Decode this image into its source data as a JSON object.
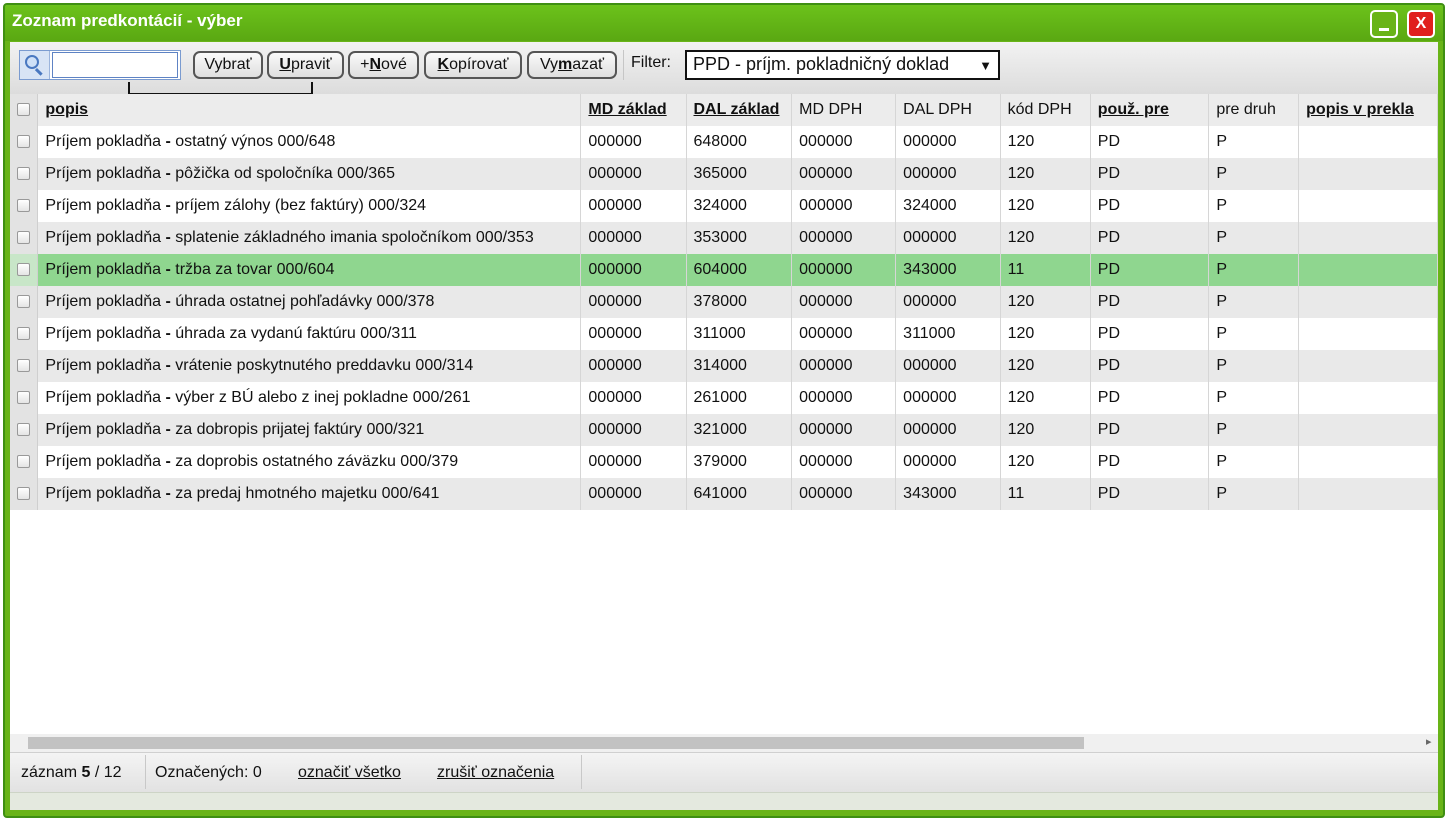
{
  "window": {
    "title": "Zoznam predkontácií - výber",
    "minimize_label": "_",
    "close_label": "X"
  },
  "toolbar": {
    "search_value": "",
    "buttons": {
      "select": {
        "pre": "Vybrať",
        "key": "",
        "post": ""
      },
      "edit": {
        "pre": "",
        "key": "U",
        "post": "praviť"
      },
      "new": {
        "pre": "+",
        "key": "N",
        "post": "ové"
      },
      "copy": {
        "pre": "",
        "key": "K",
        "post": "opírovať"
      },
      "delete": {
        "pre": "Vy",
        "key": "m",
        "post": "azať"
      }
    },
    "filter_label": "Filter:",
    "filter_value": "PPD - príjm. pokladničný doklad",
    "filter_arrow": "▼"
  },
  "table": {
    "columns": [
      "popis",
      "MD základ",
      "DAL základ",
      "MD DPH",
      "DAL DPH",
      "kód DPH",
      "použ. pre",
      "pre druh",
      "popis v prekla"
    ],
    "rows": [
      {
        "prefix": "Príjem pokladňa",
        "rest": "ostatný výnos 000/648",
        "md": "000000",
        "dal": "648000",
        "mddph": "000000",
        "daldph": "000000",
        "kod": "120",
        "pouz": "PD",
        "druh": "P",
        "prekl": ""
      },
      {
        "prefix": "Príjem pokladňa",
        "rest": "pôžička od spoločníka 000/365",
        "md": "000000",
        "dal": "365000",
        "mddph": "000000",
        "daldph": "000000",
        "kod": "120",
        "pouz": "PD",
        "druh": "P",
        "prekl": ""
      },
      {
        "prefix": "Príjem pokladňa",
        "rest": "príjem zálohy (bez faktúry) 000/324",
        "md": "000000",
        "dal": "324000",
        "mddph": "000000",
        "daldph": "324000",
        "kod": "120",
        "pouz": "PD",
        "druh": "P",
        "prekl": ""
      },
      {
        "prefix": "Príjem pokladňa",
        "rest": "splatenie základného imania spoločníkom 000/353",
        "md": "000000",
        "dal": "353000",
        "mddph": "000000",
        "daldph": "000000",
        "kod": "120",
        "pouz": "PD",
        "druh": "P",
        "prekl": ""
      },
      {
        "prefix": "Príjem pokladňa",
        "rest": "tržba za tovar 000/604",
        "md": "000000",
        "dal": "604000",
        "mddph": "000000",
        "daldph": "343000",
        "kod": "11",
        "pouz": "PD",
        "druh": "P",
        "prekl": ""
      },
      {
        "prefix": "Príjem pokladňa",
        "rest": "úhrada ostatnej pohľadávky 000/378",
        "md": "000000",
        "dal": "378000",
        "mddph": "000000",
        "daldph": "000000",
        "kod": "120",
        "pouz": "PD",
        "druh": "P",
        "prekl": ""
      },
      {
        "prefix": "Príjem pokladňa",
        "rest": "úhrada za vydanú faktúru 000/311",
        "md": "000000",
        "dal": "311000",
        "mddph": "000000",
        "daldph": "311000",
        "kod": "120",
        "pouz": "PD",
        "druh": "P",
        "prekl": ""
      },
      {
        "prefix": "Príjem pokladňa",
        "rest": "vrátenie poskytnutého preddavku 000/314",
        "md": "000000",
        "dal": "314000",
        "mddph": "000000",
        "daldph": "000000",
        "kod": "120",
        "pouz": "PD",
        "druh": "P",
        "prekl": ""
      },
      {
        "prefix": "Príjem pokladňa",
        "rest": "výber z BÚ alebo z inej pokladne 000/261",
        "md": "000000",
        "dal": "261000",
        "mddph": "000000",
        "daldph": "000000",
        "kod": "120",
        "pouz": "PD",
        "druh": "P",
        "prekl": ""
      },
      {
        "prefix": "Príjem pokladňa",
        "rest": "za dobropis prijatej faktúry 000/321",
        "md": "000000",
        "dal": "321000",
        "mddph": "000000",
        "daldph": "000000",
        "kod": "120",
        "pouz": "PD",
        "druh": "P",
        "prekl": ""
      },
      {
        "prefix": "Príjem pokladňa",
        "rest": "za doprobis ostatného záväzku 000/379",
        "md": "000000",
        "dal": "379000",
        "mddph": "000000",
        "daldph": "000000",
        "kod": "120",
        "pouz": "PD",
        "druh": "P",
        "prekl": ""
      },
      {
        "prefix": "Príjem pokladňa",
        "rest": "za predaj hmotného majetku 000/641",
        "md": "000000",
        "dal": "641000",
        "mddph": "000000",
        "daldph": "343000",
        "kod": "11",
        "pouz": "PD",
        "druh": "P",
        "prekl": ""
      }
    ]
  },
  "status": {
    "record_label": "záznam",
    "record_current": "5",
    "record_total": "/ 12",
    "marked": "Označených: 0",
    "mark_all": "označiť všetko",
    "unmark": "zrušiť označenia"
  },
  "colors": {
    "title_green": "#69b418",
    "selected_row": "#8fd68f",
    "close_red": "#e0201d"
  },
  "icons": {
    "search": "magnifier-icon",
    "dropdown": "chevron-down-icon"
  }
}
